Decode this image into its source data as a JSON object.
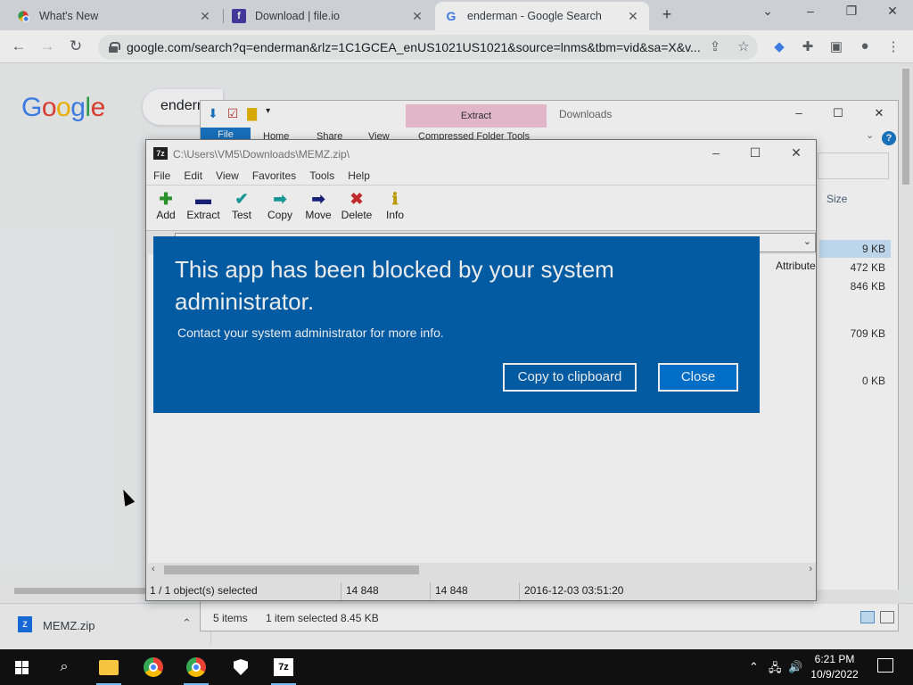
{
  "browser": {
    "tabs": [
      {
        "title": "What's New",
        "favicon": "chrome-icon"
      },
      {
        "title": "Download | file.io",
        "favicon": "fileio-icon"
      },
      {
        "title": "enderman - Google Search",
        "favicon": "google-icon",
        "active": true
      }
    ],
    "url": "google.com/search?q=enderman&rlz=1C1GCEA_enUS1021US1021&source=lnms&tbm=vid&sa=X&v...",
    "new_tab": "+",
    "controls": {
      "minimize": "–",
      "restore": "❐",
      "close": "✕",
      "tab_menu": "⌄"
    }
  },
  "google": {
    "logo": [
      "G",
      "o",
      "o",
      "g",
      "l",
      "e"
    ],
    "logo_colors": [
      "#4285f4",
      "#ea4335",
      "#fbbc05",
      "#4285f4",
      "#34a853",
      "#ea4335"
    ],
    "search_text": "enderm"
  },
  "downloads_shelf": {
    "file_name": "MEMZ.zip",
    "file_icon": "Z"
  },
  "explorer": {
    "title": "Downloads",
    "extract_tab": "Extract",
    "tools_label": "Compressed Folder Tools",
    "ribbon_tabs": [
      "File",
      "Home",
      "Share",
      "View"
    ],
    "size_header": "Size",
    "sizes": [
      "9 KB",
      "472 KB",
      "846 KB",
      "709 KB",
      "0 KB"
    ],
    "status_items": "5 items",
    "status_selected": "1 item selected  8.45 KB",
    "help": "?"
  },
  "sevenzip": {
    "title_path": "C:\\Users\\VM5\\Downloads\\MEMZ.zip\\",
    "icon": "7z",
    "menu": [
      "File",
      "Edit",
      "View",
      "Favorites",
      "Tools",
      "Help"
    ],
    "tools": [
      {
        "label": "Add",
        "glyph": "✚",
        "color": "#2e9e2e"
      },
      {
        "label": "Extract",
        "glyph": "▬",
        "color": "#1a237e"
      },
      {
        "label": "Test",
        "glyph": "✔",
        "color": "#1aa3a3"
      },
      {
        "label": "Copy",
        "glyph": "➡",
        "color": "#1aa3a3"
      },
      {
        "label": "Move",
        "glyph": "➡",
        "color": "#1a237e"
      },
      {
        "label": "Delete",
        "glyph": "✖",
        "color": "#d32f2f"
      },
      {
        "label": "Info",
        "glyph": "ℹ",
        "color": "#c9a800"
      }
    ],
    "column_attributes": "Attribute",
    "status": {
      "selected": "1 / 1 object(s) selected",
      "size": "14 848",
      "packed": "14 848",
      "modified": "2016-12-03 03:51:20"
    }
  },
  "dialog": {
    "heading": "This app has been blocked by your system administrator.",
    "message": "Contact your system administrator for more info.",
    "copy_button": "Copy to clipboard",
    "close_button": "Close",
    "background_color": "#0063b1"
  },
  "taskbar": {
    "time": "6:21 PM",
    "date": "10/9/2022",
    "notification_count": ""
  }
}
